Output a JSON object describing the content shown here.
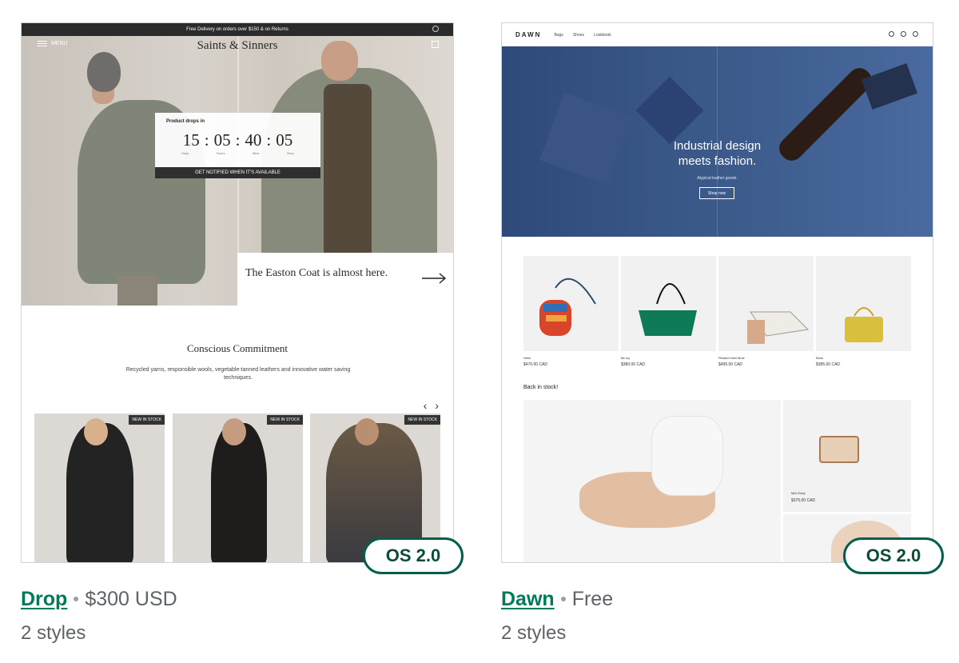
{
  "themes": [
    {
      "name": "Drop",
      "price": "$300 USD",
      "styles": "2 styles",
      "badge": "OS 2.0",
      "preview": {
        "announcement": "Free Delivery on orders over $150 & on Returns",
        "brand": "Saints & Sinners",
        "menu_label": "MENU",
        "countdown": {
          "label": "Product drops in",
          "days": "15",
          "hours": "05",
          "mins": "40",
          "secs": "05",
          "units": [
            "Days",
            "Hours",
            "Mins",
            "Secs"
          ],
          "cta": "GET NOTIFIED WHEN IT'S AVAILABLE"
        },
        "promo": "The Easton Coat is almost here.",
        "section_title": "Conscious Commitment",
        "section_body": "Recycled yarns, responsible wools, vegetable-tanned leathers and innovative water saving techniques.",
        "product_tag": "NEW IN STOCK"
      }
    },
    {
      "name": "Dawn",
      "price": "Free",
      "styles": "2 styles",
      "badge": "OS 2.0",
      "preview": {
        "logo": "DAWN",
        "nav": [
          "Bags",
          "Shoes",
          "Lookbook"
        ],
        "hero_title_1": "Industrial design",
        "hero_title_2": "meets fashion.",
        "hero_sub": "Atypical leather goods.",
        "hero_button": "Shop now",
        "products": [
          {
            "name": "Hello",
            "price": "$470.00 CAD"
          },
          {
            "name": "Be Icy",
            "price": "$380.00 CAD"
          },
          {
            "name": "Pleated Heel Mule",
            "price": "$495.00 CAD"
          },
          {
            "name": "Brick",
            "price": "$385.00 CAD"
          }
        ],
        "back_in_stock": "Back in stock!",
        "side_product": {
          "name": "Mini Eddy",
          "price": "$375.00 CAD"
        }
      }
    }
  ],
  "colors": {
    "link_green": "#007a5a",
    "badge_border": "#005e4a",
    "muted_text": "#5e6368"
  }
}
